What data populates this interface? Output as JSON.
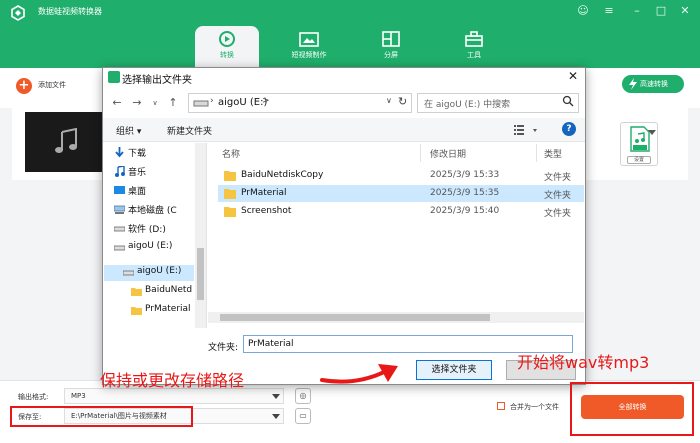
{
  "app": {
    "title": "数据蛙视频转换器",
    "nav_tabs": [
      {
        "label": "转换",
        "icon": "convert-icon",
        "active": true
      },
      {
        "label": "短视频制作",
        "icon": "video-maker-icon",
        "active": false
      },
      {
        "label": "分屏",
        "icon": "split-screen-icon",
        "active": false
      },
      {
        "label": "工具",
        "icon": "toolbox-icon",
        "active": false
      }
    ],
    "window_controls": [
      "feedback-icon",
      "menu-icon",
      "minimize-icon",
      "maximize-icon",
      "close-icon"
    ],
    "add_file_label": "添加文件",
    "fast_convert_label": "高速转换",
    "format_settings_label": "设置",
    "output_format_label": "输出格式:",
    "output_format_value": "MP3",
    "save_to_label": "保存至:",
    "save_to_value": "E:\\PrMaterial\\图片与视频素材",
    "merge_label": "合并为一个文件",
    "convert_all_label": "全部转换",
    "accent_color": "#1fae6b",
    "action_color": "#f05a28"
  },
  "dialog": {
    "title": "选择输出文件夹",
    "address": {
      "drive": "aigoU (E:)",
      "separator": ">"
    },
    "search_placeholder": "在 aigoU (E:) 中搜索",
    "toolbar": {
      "organize": "组织 ▾",
      "new_folder": "新建文件夹"
    },
    "nav_items": [
      {
        "label": "下载",
        "icon": "download-icon"
      },
      {
        "label": "音乐",
        "icon": "music-icon"
      },
      {
        "label": "桌面",
        "icon": "desktop-icon"
      },
      {
        "label": "本地磁盘 (C",
        "icon": "disk-icon"
      },
      {
        "label": "软件 (D:)",
        "icon": "drive-icon"
      },
      {
        "label": "aigoU (E:)",
        "icon": "drive-icon"
      },
      {
        "label": "aigoU (E:)",
        "icon": "usb-drive-icon"
      },
      {
        "label": "BaiduNetd",
        "icon": "folder-icon"
      },
      {
        "label": "PrMaterial",
        "icon": "folder-icon"
      }
    ],
    "columns": {
      "name": "名称",
      "date": "修改日期",
      "type": "类型"
    },
    "files": [
      {
        "name": "BaiduNetdiskCopy",
        "date": "2025/3/9 15:33",
        "type": "文件夹",
        "selected": false
      },
      {
        "name": "PrMaterial",
        "date": "2025/3/9 15:35",
        "type": "文件夹",
        "selected": true
      },
      {
        "name": "Screenshot",
        "date": "2025/3/9 15:40",
        "type": "文件夹",
        "selected": false
      }
    ],
    "folder_label": "文件夹:",
    "folder_value": "PrMaterial",
    "select_button": "选择文件夹"
  },
  "annotations": {
    "keep_path": "保持或更改存储路径",
    "start_convert": "开始将wav转mp3"
  }
}
